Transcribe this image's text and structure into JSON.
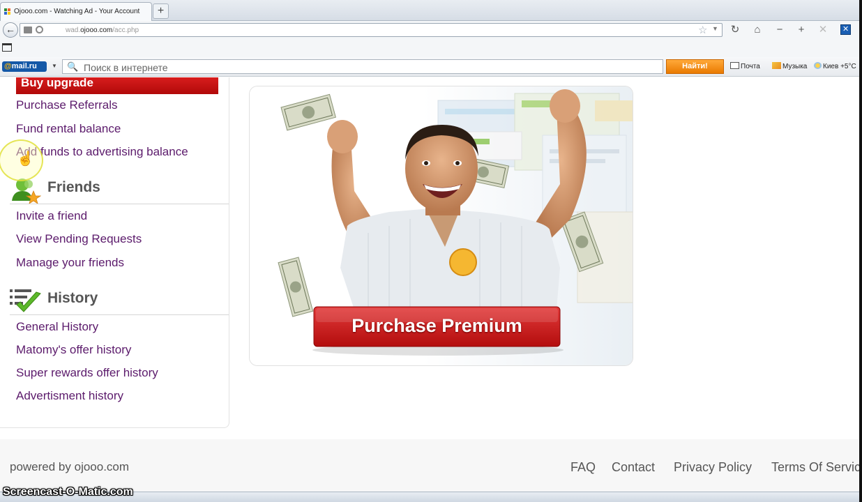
{
  "browser": {
    "tab_title": "Ojooo.com - Watching Ad - Your Account",
    "new_tab_label": "+",
    "url_prefix": "wad.",
    "url_domain": "ojooo.com",
    "url_path": "/acc.php"
  },
  "mailru_bar": {
    "logo_at": "@",
    "logo_text": "mail.ru",
    "search_placeholder": "Поиск в интернете",
    "find_button": "Найти!",
    "mail_link": "Почта",
    "music_link": "Музыка",
    "weather_link": "Киев +5°C"
  },
  "sidebar": {
    "buy_upgrade": "Buy upgrade",
    "upgrade_links": [
      "Purchase Referrals",
      "Fund rental balance",
      "Add funds to advertising balance"
    ],
    "friends_title": "Friends",
    "friends_links": [
      "Invite a friend",
      "View Pending Requests",
      "Manage your friends"
    ],
    "history_title": "History",
    "history_links": [
      "General History",
      "Matomy's offer history",
      "Super rewards offer history",
      "Advertisment history"
    ]
  },
  "banner": {
    "button_label": "Purchase Premium"
  },
  "footer": {
    "powered_by": "powered by ojooo.com",
    "links": [
      "FAQ",
      "Contact",
      "Privacy Policy",
      "Terms Of Service"
    ]
  },
  "watermark": "Screencast-O-Matic.com"
}
